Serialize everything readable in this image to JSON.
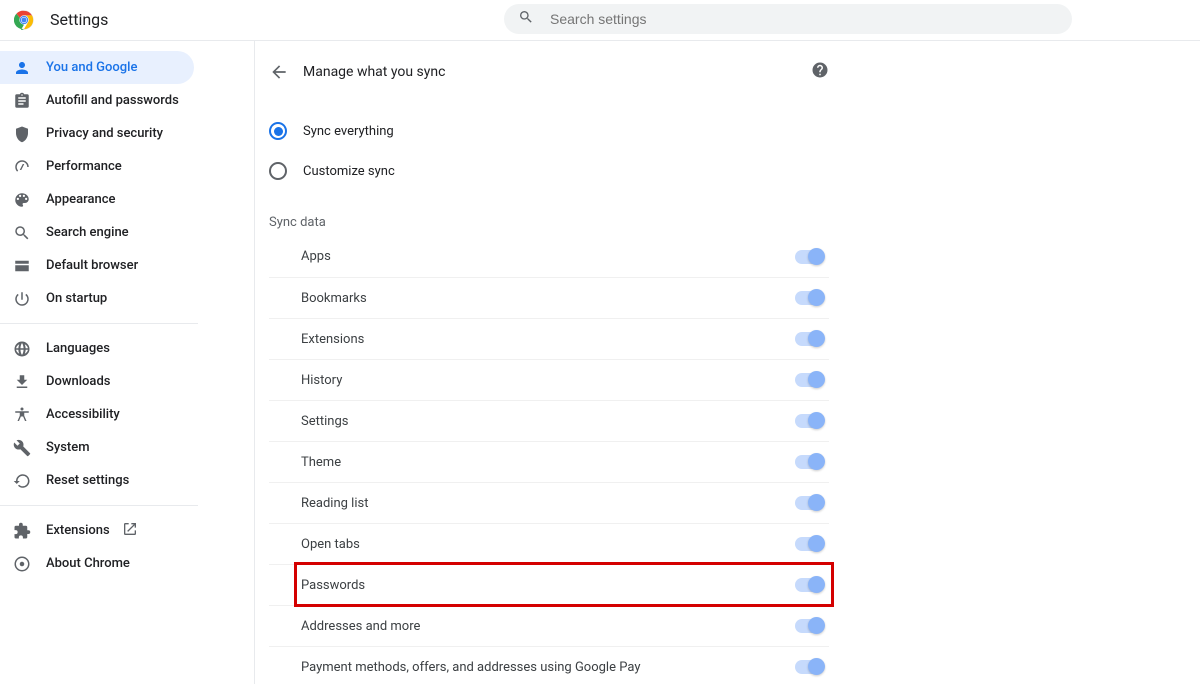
{
  "app": {
    "title": "Settings"
  },
  "search": {
    "placeholder": "Search settings"
  },
  "sidebar": {
    "groups": [
      [
        "You and Google",
        "Autofill and passwords",
        "Privacy and security",
        "Performance",
        "Appearance",
        "Search engine",
        "Default browser",
        "On startup"
      ],
      [
        "Languages",
        "Downloads",
        "Accessibility",
        "System",
        "Reset settings"
      ],
      [
        "Extensions",
        "About Chrome"
      ]
    ]
  },
  "main": {
    "header": "Manage what you sync",
    "radio": {
      "opt1": "Sync everything",
      "opt2": "Customize sync"
    },
    "section_label": "Sync data",
    "items": [
      "Apps",
      "Bookmarks",
      "Extensions",
      "History",
      "Settings",
      "Theme",
      "Reading list",
      "Open tabs",
      "Passwords",
      "Addresses and more",
      "Payment methods, offers, and addresses using Google Pay"
    ]
  },
  "highlight": {
    "target": "Passwords"
  }
}
